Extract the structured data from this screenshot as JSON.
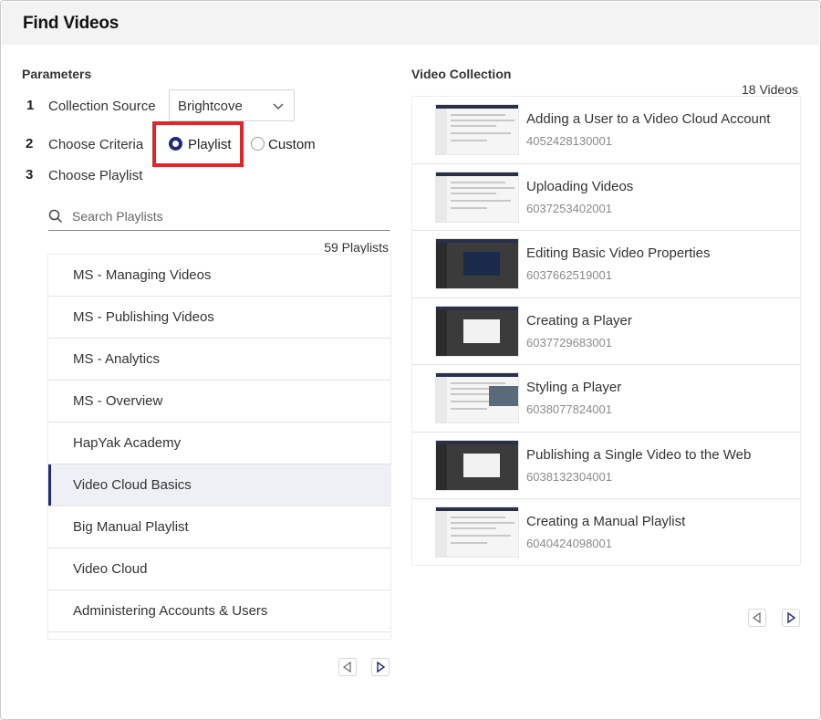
{
  "header": {
    "title": "Find Videos"
  },
  "parameters": {
    "title": "Parameters",
    "steps": [
      {
        "num": "1",
        "label": "Collection Source"
      },
      {
        "num": "2",
        "label": "Choose Criteria"
      },
      {
        "num": "3",
        "label": "Choose Playlist"
      }
    ],
    "source_select": {
      "value": "Brightcove"
    },
    "criteria": {
      "options": [
        {
          "label": "Playlist",
          "selected": true
        },
        {
          "label": "Custom",
          "selected": false
        }
      ],
      "highlight_color": "#e0262b"
    },
    "search": {
      "placeholder": "Search Playlists",
      "value": ""
    },
    "playlist_count": "59 Playlists",
    "playlists": [
      "MS - Managing Videos",
      "MS - Publishing Videos",
      "MS - Analytics",
      "MS - Overview",
      "HapYak Academy",
      "Video Cloud Basics",
      "Big Manual Playlist",
      "Video Cloud",
      "Administering Accounts & Users"
    ],
    "active_playlist_index": 5
  },
  "collection": {
    "title": "Video Collection",
    "count": "18 Videos",
    "videos": [
      {
        "title": "Adding a User to a Video Cloud Account",
        "id": "4052428130001",
        "thumb": "light"
      },
      {
        "title": "Uploading Videos",
        "id": "6037253402001",
        "thumb": "light"
      },
      {
        "title": "Editing Basic Video Properties",
        "id": "6037662519001",
        "thumb": "dark"
      },
      {
        "title": "Creating a Player",
        "id": "6037729683001",
        "thumb": "dark"
      },
      {
        "title": "Styling a Player",
        "id": "6038077824001",
        "thumb": "light"
      },
      {
        "title": "Publishing a Single Video to the Web",
        "id": "6038132304001",
        "thumb": "dark"
      },
      {
        "title": "Creating a Manual Playlist",
        "id": "6040424098001",
        "thumb": "light"
      }
    ]
  },
  "colors": {
    "accent": "#1f2a7a",
    "header_bg": "#f3f3f3"
  },
  "icons": {
    "search": "search-icon",
    "dropdown": "chevron-down-icon",
    "prev": "triangle-left-icon",
    "next": "triangle-right-icon"
  }
}
